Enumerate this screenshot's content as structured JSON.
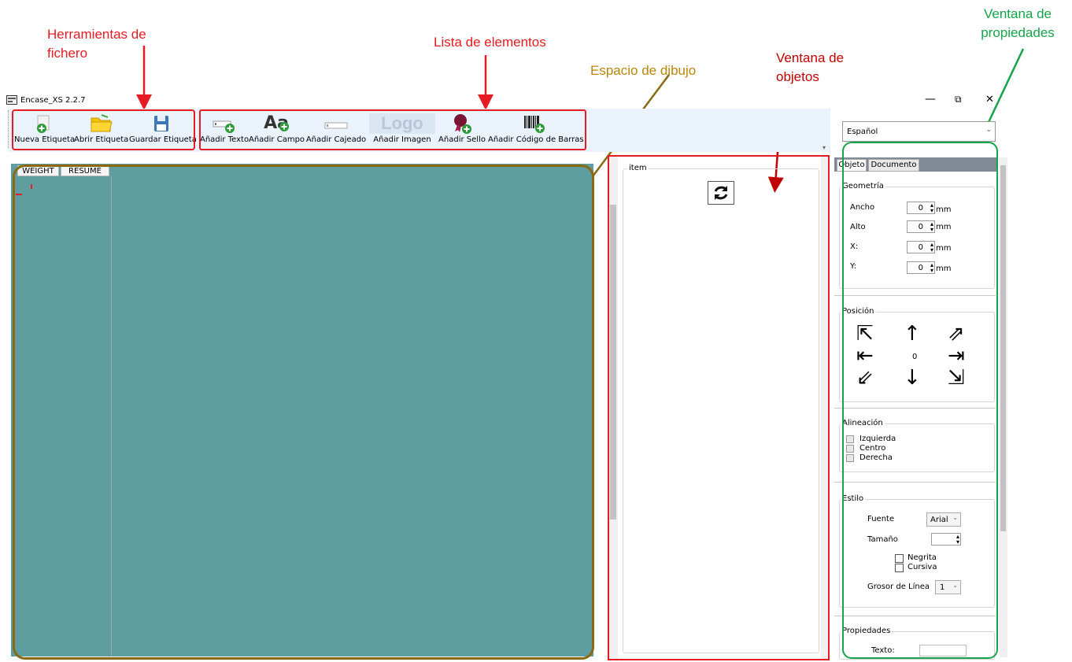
{
  "annotations": {
    "file_tools": "Herramientas de\nfichero",
    "elements_list": "Lista de elementos",
    "drawing_space": "Espacio de dibujo",
    "objects_window": "Ventana de\nobjetos",
    "properties_window": "Ventana de\npropiedades"
  },
  "window": {
    "title": "Encase_XS 2.2.7",
    "minimize": "—",
    "restore": "⧉",
    "close": "✕"
  },
  "toolbar": {
    "new_label": "Nueva Etiqueta",
    "open_label": "Abrir Etiqueta",
    "save_label": "Guardar Etiqueta",
    "add_text_label": "Añadir Texto",
    "add_field_label": "Añadir Campo",
    "add_box_label": "Añadir Cajeado",
    "add_image_label": "Añadir Imagen",
    "add_image_logo": "Logo",
    "add_stamp_label": "Añadir Sello",
    "add_barcode_label": "Añadir Código de Barras",
    "add_field_glyph": "Aa"
  },
  "canvas": {
    "tabs": [
      "WEIGHT",
      "RESUME"
    ]
  },
  "objects": {
    "group_title": "item"
  },
  "language": {
    "selected": "Español"
  },
  "properties": {
    "tabs": [
      "Objeto",
      "Documento"
    ],
    "geometry": {
      "title": "Geometría",
      "rows": [
        {
          "label": "Ancho",
          "value": "0",
          "unit": "mm"
        },
        {
          "label": "Alto",
          "value": "0",
          "unit": "mm"
        },
        {
          "label": "X:",
          "value": "0",
          "unit": "mm"
        },
        {
          "label": "Y:",
          "value": "0",
          "unit": "mm"
        }
      ]
    },
    "position": {
      "title": "Posición",
      "value": "0"
    },
    "alignment": {
      "title": "Alineación",
      "options": [
        "Izquierda",
        "Centro",
        "Derecha"
      ]
    },
    "style": {
      "title": "Estilo",
      "font_label": "Fuente",
      "font_value": "Arial",
      "size_label": "Tamaño",
      "bold_label": "Negrita",
      "italic_label": "Cursiva",
      "line_label": "Grosor de Línea",
      "line_value": "1"
    },
    "props": {
      "title": "Propiedades",
      "text_label": "Texto:"
    }
  }
}
